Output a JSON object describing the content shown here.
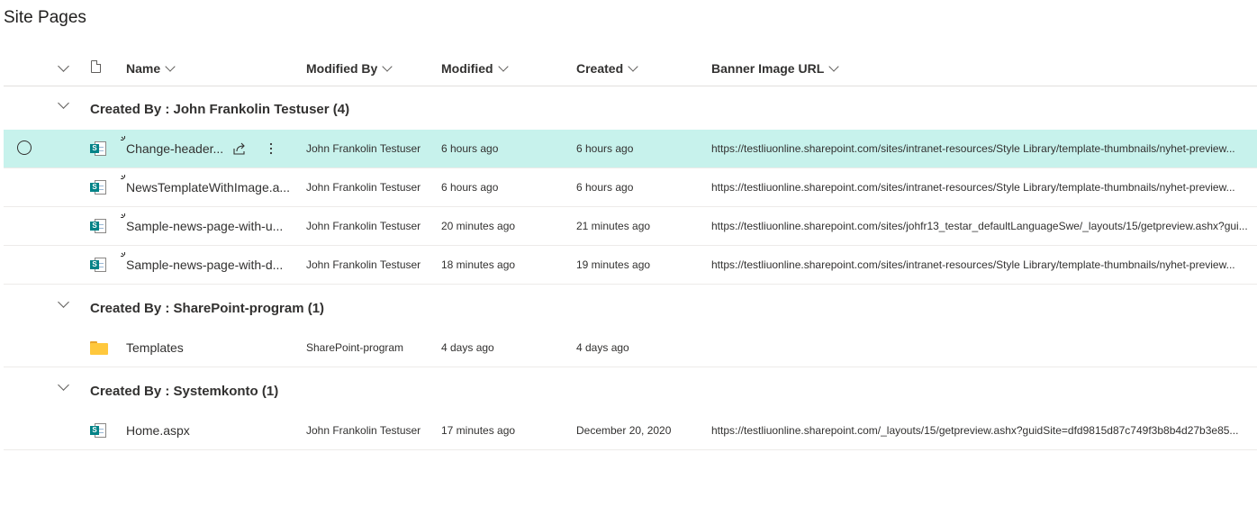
{
  "title": "Site Pages",
  "columns": {
    "name": "Name",
    "modified_by": "Modified By",
    "modified": "Modified",
    "created": "Created",
    "banner": "Banner Image URL"
  },
  "groups": [
    {
      "label": "Created By : John Frankolin Testuser (4)",
      "rows": [
        {
          "name": "Change-header...",
          "modified_by": "John Frankolin Testuser",
          "modified": "6 hours ago",
          "created": "6 hours ago",
          "banner": "https://testliuonline.sharepoint.com/sites/intranet-resources/Style Library/template-thumbnails/nyhet-preview...",
          "icon": "sharepoint-page-icon",
          "is_new": true,
          "selected": true
        },
        {
          "name": "NewsTemplateWithImage.a...",
          "modified_by": "John Frankolin Testuser",
          "modified": "6 hours ago",
          "created": "6 hours ago",
          "banner": "https://testliuonline.sharepoint.com/sites/intranet-resources/Style Library/template-thumbnails/nyhet-preview...",
          "icon": "sharepoint-page-icon",
          "is_new": true
        },
        {
          "name": "Sample-news-page-with-u...",
          "modified_by": "John Frankolin Testuser",
          "modified": "20 minutes ago",
          "created": "21 minutes ago",
          "banner": "https://testliuonline.sharepoint.com/sites/johfr13_testar_defaultLanguageSwe/_layouts/15/getpreview.ashx?gui...",
          "icon": "sharepoint-page-icon",
          "is_new": true
        },
        {
          "name": "Sample-news-page-with-d...",
          "modified_by": "John Frankolin Testuser",
          "modified": "18 minutes ago",
          "created": "19 minutes ago",
          "banner": "https://testliuonline.sharepoint.com/sites/intranet-resources/Style Library/template-thumbnails/nyhet-preview...",
          "icon": "sharepoint-page-icon",
          "is_new": true
        }
      ]
    },
    {
      "label": "Created By : SharePoint-program (1)",
      "rows": [
        {
          "name": "Templates",
          "modified_by": "SharePoint-program",
          "modified": "4 days ago",
          "created": "4 days ago",
          "banner": "",
          "icon": "folder-icon"
        }
      ]
    },
    {
      "label": "Created By : Systemkonto (1)",
      "rows": [
        {
          "name": "Home.aspx",
          "modified_by": "John Frankolin Testuser",
          "modified": "17 minutes ago",
          "created": "December 20, 2020",
          "banner": "https://testliuonline.sharepoint.com/_layouts/15/getpreview.ashx?guidSite=dfd9815d87c749f3b8b4d27b3e85...",
          "icon": "sharepoint-page-icon"
        }
      ]
    }
  ],
  "colors": {
    "selected_row": "#c7f2ec",
    "sharepoint_badge": "#038387",
    "folder": "#ffc83d"
  }
}
